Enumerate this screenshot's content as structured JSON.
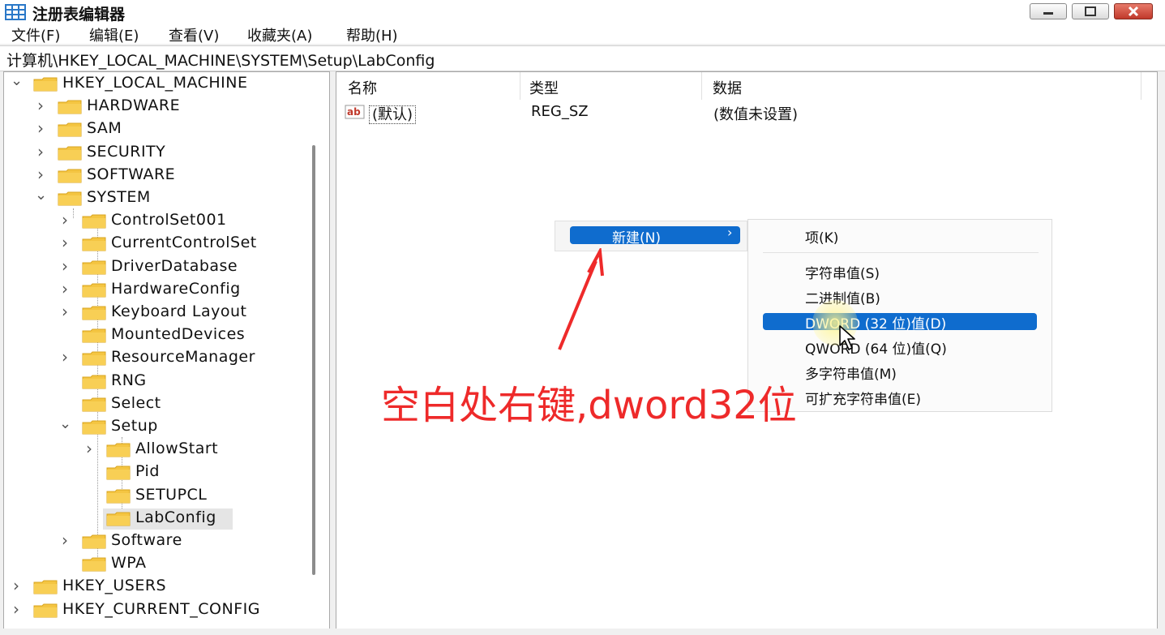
{
  "window": {
    "title": "注册表编辑器"
  },
  "menu": [
    "文件(F)",
    "编辑(E)",
    "查看(V)",
    "收藏夹(A)",
    "帮助(H)"
  ],
  "address": "计算机\\HKEY_LOCAL_MACHINE\\SYSTEM\\Setup\\LabConfig",
  "tree": {
    "hklm": "HKEY_LOCAL_MACHINE",
    "hardware": "HARDWARE",
    "sam": "SAM",
    "security": "SECURITY",
    "software": "SOFTWARE",
    "system": "SYSTEM",
    "controlset001": "ControlSet001",
    "currentcontrolset": "CurrentControlSet",
    "driverdatabase": "DriverDatabase",
    "hardwareconfig": "HardwareConfig",
    "keyboardlayout": "Keyboard Layout",
    "mounteddevices": "MountedDevices",
    "resourcemanager": "ResourceManager",
    "rng": "RNG",
    "select": "Select",
    "setup": "Setup",
    "allowstart": "AllowStart",
    "pid": "Pid",
    "setupcl": "SETUPCL",
    "labconfig": "LabConfig",
    "software2": "Software",
    "wpa": "WPA",
    "hku": "HKEY_USERS",
    "hkcc": "HKEY_CURRENT_CONFIG"
  },
  "list": {
    "columns": {
      "name": "名称",
      "type": "类型",
      "data": "数据"
    },
    "rows": [
      {
        "icon": "ab",
        "name": "(默认)",
        "type": "REG_SZ",
        "data": "(数值未设置)"
      }
    ]
  },
  "context_menu": {
    "new": "新建(N)",
    "submenu": {
      "key": "项(K)",
      "string": "字符串值(S)",
      "binary": "二进制值(B)",
      "dword": "DWORD (32 位)值(D)",
      "qword": "QWORD (64 位)值(Q)",
      "multi": "多字符串值(M)",
      "expand": "可扩充字符串值(E)"
    }
  },
  "annotation": "空白处右键,dword32位",
  "colors": {
    "accent": "#0f6cce",
    "annotation": "#ee2a2a",
    "folder": "#f4c542"
  }
}
